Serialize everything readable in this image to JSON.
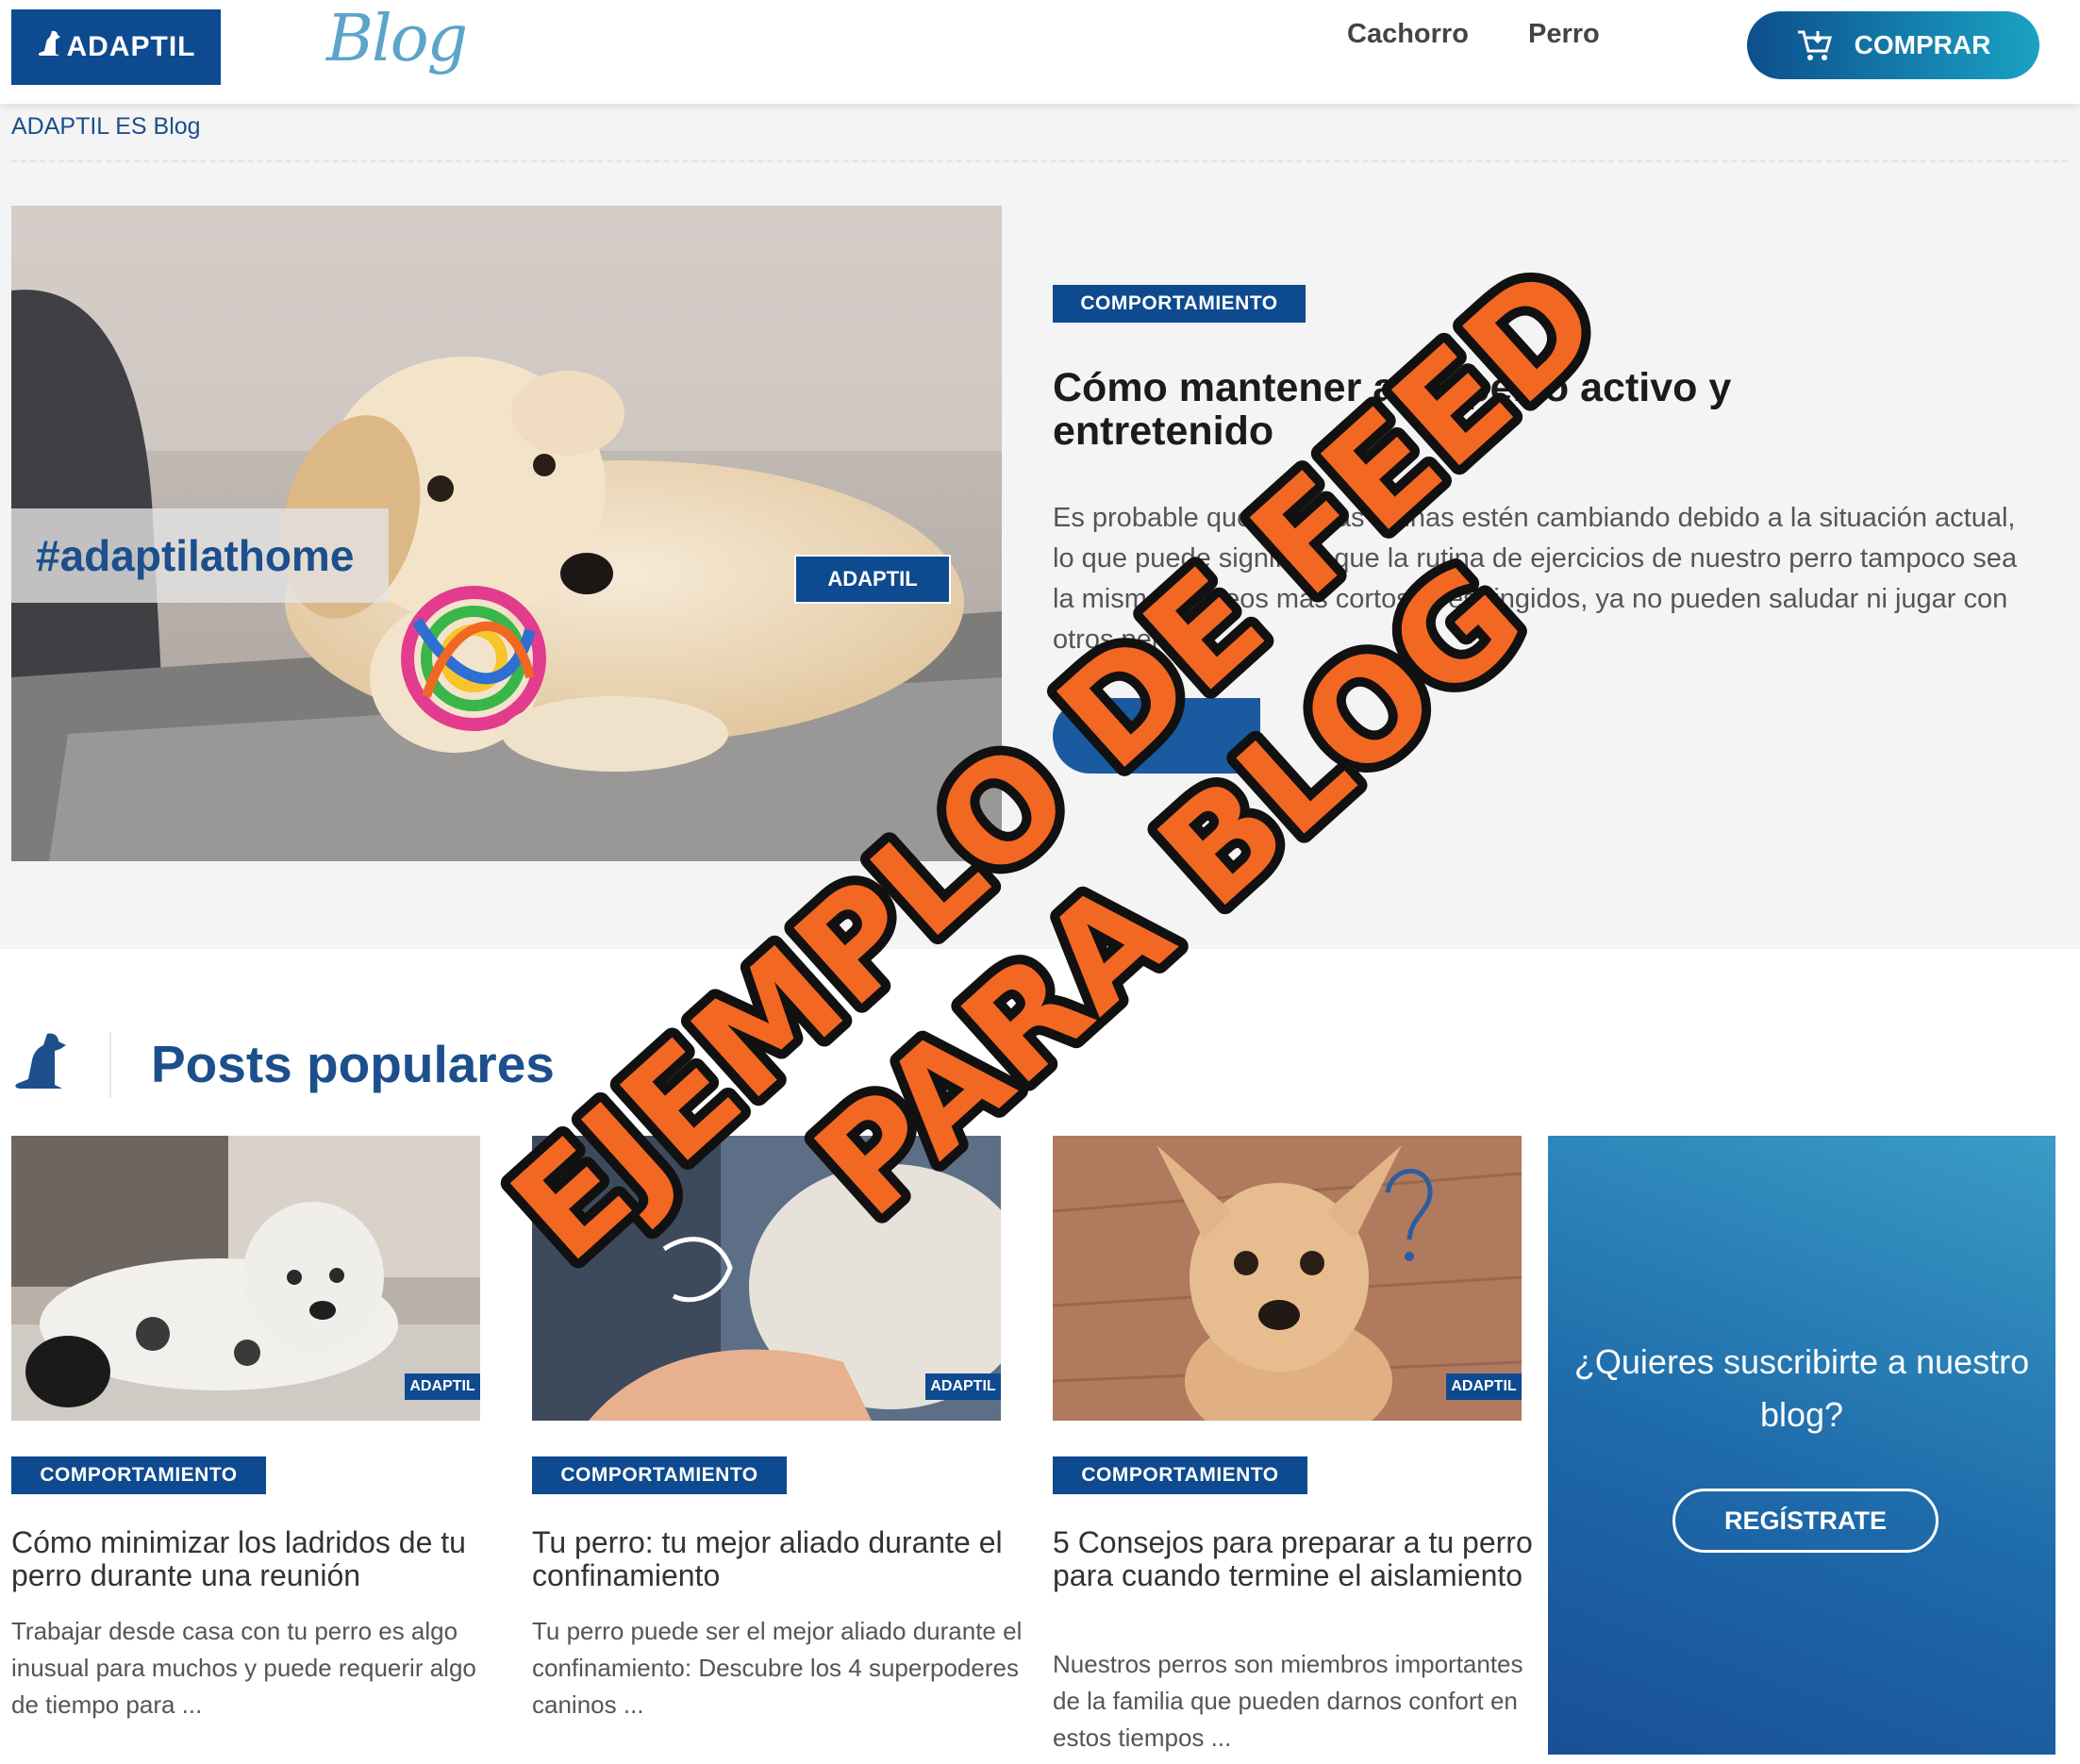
{
  "header": {
    "logo_text": "ADAPTIL",
    "blog_script": "Blog",
    "nav": [
      "Cachorro",
      "Perro"
    ],
    "buy_label": "COMPRAR"
  },
  "breadcrumb": "ADAPTIL ES Blog",
  "hero": {
    "image_hashtag": "#adaptilathome",
    "image_badge": "ADAPTIL",
    "category": "COMPORTAMIENTO",
    "title": "Cómo mantener a mi perro activo y entretenido",
    "excerpt": "Es probable que nuestras rutinas estén cambiando debido a la situación actual, lo que puede significar que la rutina de ejercicios de nuestro perro tampoco sea la misma. Paseos más cortos y restringidos, ya no pueden saludar ni jugar con otros perros ..."
  },
  "popular": {
    "title": "Posts populares",
    "image_badge": "ADAPTIL",
    "cards": [
      {
        "category": "COMPORTAMIENTO",
        "title": "Cómo minimizar los ladridos de tu perro durante una reunión",
        "excerpt": "Trabajar desde casa con tu perro es algo inusual para muchos y puede requerir algo de tiempo para ..."
      },
      {
        "category": "COMPORTAMIENTO",
        "title": "Tu perro: tu mejor aliado durante el confinamiento",
        "excerpt": "Tu perro puede ser el mejor aliado durante el confinamiento: Descubre los 4 superpoderes caninos ..."
      },
      {
        "category": "COMPORTAMIENTO",
        "title": "5 Consejos para preparar a tu perro para cuando termine el aislamiento",
        "excerpt": "Nuestros perros son miembros importantes de la familia que pueden darnos confort en estos tiempos ..."
      }
    ]
  },
  "subscribe": {
    "question": "¿Quieres suscribirte a nuestro blog?",
    "button": "REGÍSTRATE"
  },
  "overlay": {
    "line1": "EJEMPLO DE FEED",
    "line2": "PARA BLOG"
  },
  "colors": {
    "brand_blue": "#0e4a8f",
    "overlay_orange": "#f26722"
  },
  "icons": [
    "cart-icon",
    "sitting-dog-icon"
  ]
}
